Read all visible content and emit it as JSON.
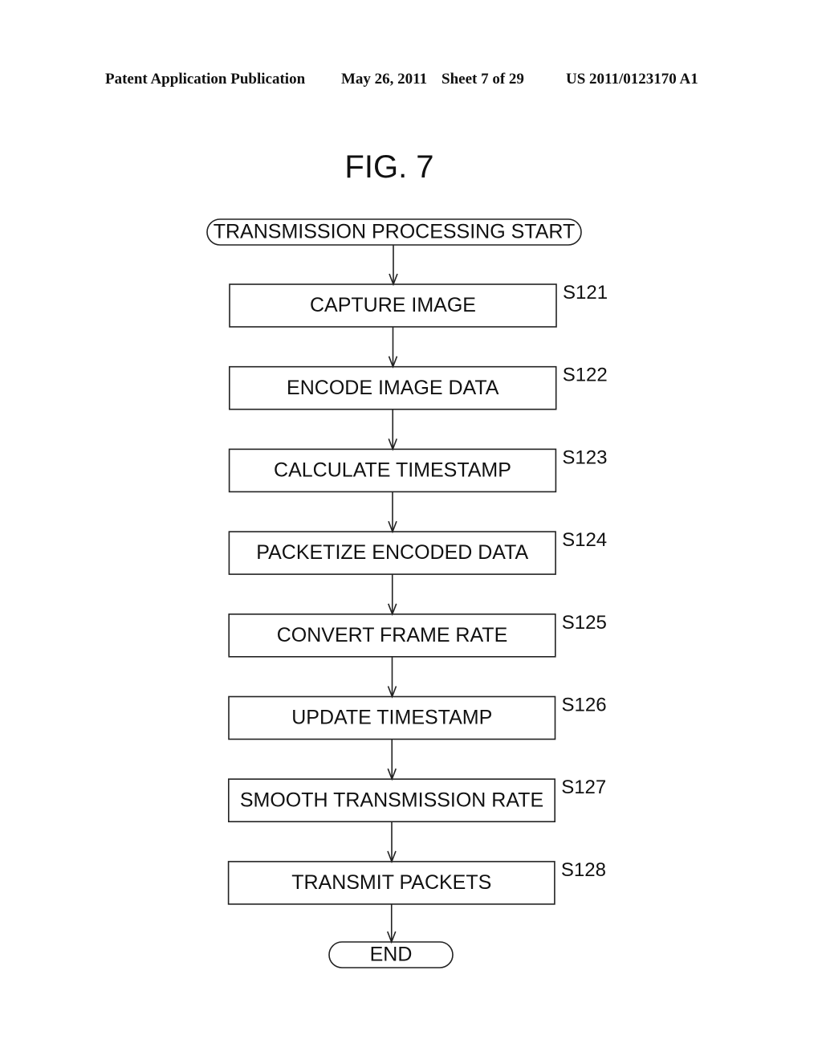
{
  "header": {
    "publication": "Patent Application Publication",
    "date": "May 26, 2011",
    "sheet": "Sheet 7 of 29",
    "number": "US 2011/0123170 A1"
  },
  "figure": {
    "title": "FIG. 7",
    "start": "TRANSMISSION PROCESSING START",
    "steps": [
      {
        "id": "S121",
        "label": "CAPTURE IMAGE"
      },
      {
        "id": "S122",
        "label": "ENCODE IMAGE DATA"
      },
      {
        "id": "S123",
        "label": "CALCULATE TIMESTAMP"
      },
      {
        "id": "S124",
        "label": "PACKETIZE ENCODED DATA"
      },
      {
        "id": "S125",
        "label": "CONVERT FRAME RATE"
      },
      {
        "id": "S126",
        "label": "UPDATE TIMESTAMP"
      },
      {
        "id": "S127",
        "label": "SMOOTH TRANSMISSION RATE"
      },
      {
        "id": "S128",
        "label": "TRANSMIT PACKETS"
      }
    ],
    "end": "END"
  }
}
